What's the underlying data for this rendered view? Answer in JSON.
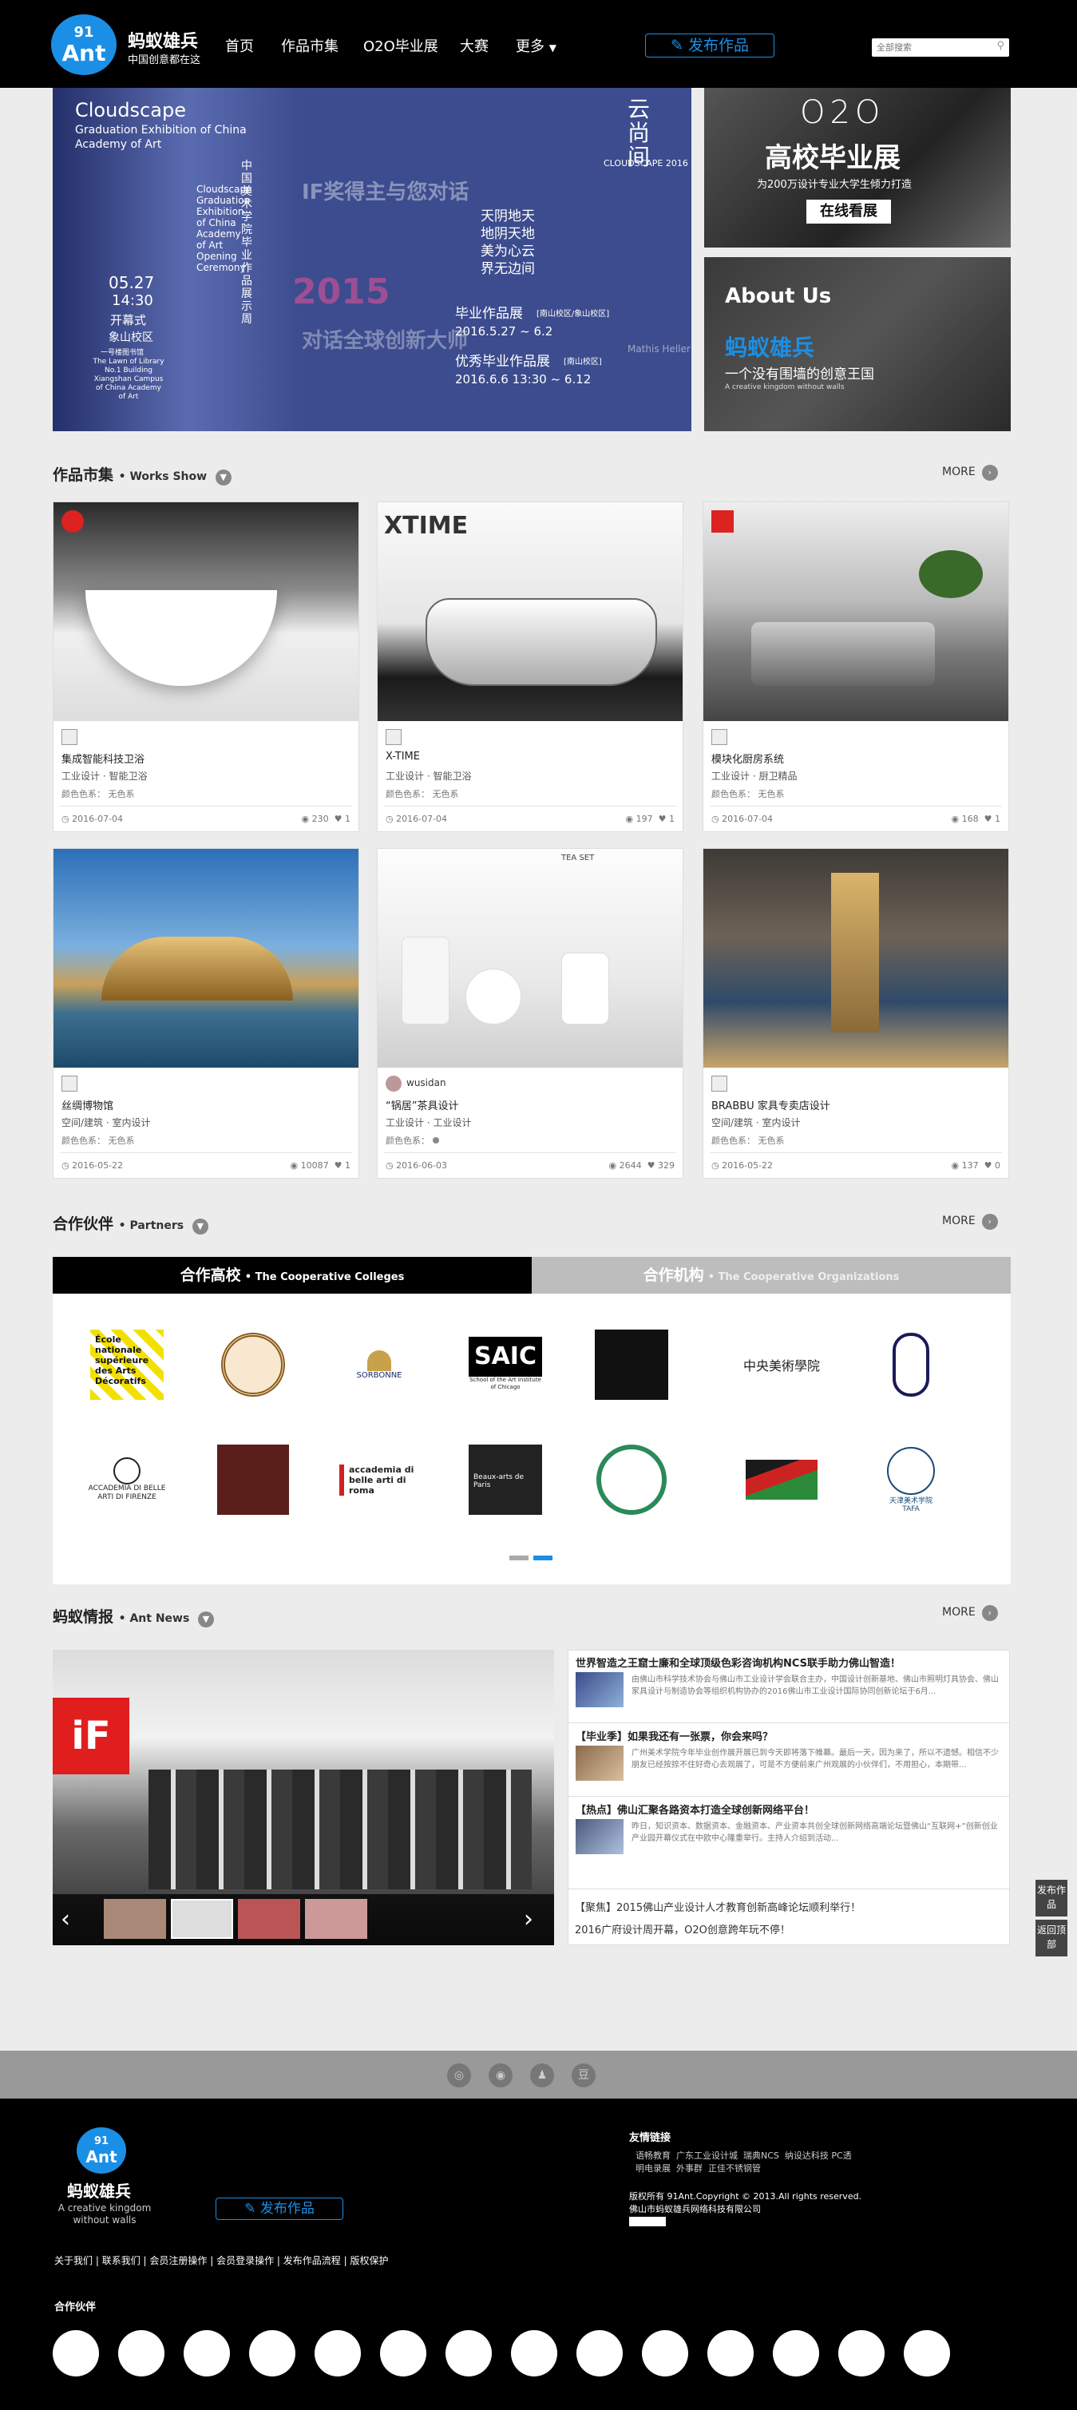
{
  "header": {
    "logo_top": "91",
    "logo_bottom": "Ant",
    "brand_name": "蚂蚁雄兵",
    "brand_slogan": "中国创意都在这",
    "nav": [
      "首页",
      "作品市集",
      "O2O毕业展",
      "大赛",
      "更多"
    ],
    "publish_label": "发布作品",
    "search_placeholder": "全部搜索"
  },
  "hero": {
    "left_title": "Cloudscape",
    "left_subtitle": "Graduation Exhibition of China Academy of Art",
    "vertical_cn": "中国美术学院毕业作品展示周",
    "vertical_en": "Cloudscape Graduation Exhibition of China Academy of Art Opening Ceremony",
    "date1": "05.27",
    "time1": "14:30",
    "open": "开幕式",
    "campus": "象山校区",
    "building": "一号楼图书馆",
    "building_en": "The Lawn of Library No.1 Building Xiangshan Campus of China Academy of Art",
    "overlay1": "IF奖得主与您对话",
    "overlay2": "对话全球创新大师",
    "year": "2015",
    "cloudscape_small": "CLOUDSCAPE 2016",
    "yunshang": "云尚间",
    "poem1": "天阴地天",
    "poem2": "地阴天地",
    "poem3": "美为心云",
    "poem4": "界无边间",
    "show1": "毕业作品展",
    "show1_place": "[南山校区/象山校区]",
    "show1_date": "2016.5.27 ~ 6.2",
    "show2": "优秀毕业作品展",
    "show2_place": "[南山校区]",
    "show2_date": "2016.6.6 13:30 ~ 6.12",
    "name": "Mathis Heller",
    "o2o_title": "O2O",
    "o2o_sub": "高校毕业展",
    "o2o_desc": "为200万设计专业大学生倾力打造",
    "o2o_button": "在线看展",
    "about_title": "About Us",
    "about_cn": "蚂蚁雄兵",
    "about_line": "一个没有围墙的创意王国",
    "about_en": "A creative kingdom without walls"
  },
  "works": {
    "title": "作品市集",
    "title_en": "Works Show",
    "more": "MORE",
    "color_label": "颜色色系：",
    "items": [
      {
        "title": "集成智能科技卫浴",
        "cat": "工业设计 · 智能卫浴",
        "color": "无色系",
        "date": "2016-07-04",
        "views": "230",
        "likes": "1",
        "author": ""
      },
      {
        "title": "X-TIME",
        "cat": "工业设计 · 智能卫浴",
        "color": "无色系",
        "date": "2016-07-04",
        "views": "197",
        "likes": "1",
        "author": ""
      },
      {
        "title": "模块化厨房系统",
        "cat": "工业设计 · 厨卫精品",
        "color": "无色系",
        "date": "2016-07-04",
        "views": "168",
        "likes": "1",
        "author": ""
      },
      {
        "title": "丝绸博物馆",
        "cat": "空间/建筑 · 室内设计",
        "color": "无色系",
        "date": "2016-05-22",
        "views": "10087",
        "likes": "1",
        "author": ""
      },
      {
        "title": "“锅居”茶具设计",
        "cat": "工业设计 · 工业设计",
        "color": "",
        "date": "2016-06-03",
        "views": "2644",
        "likes": "329",
        "author": "wusidan"
      },
      {
        "title": "BRABBU 家具专卖店设计",
        "cat": "空间/建筑 · 室内设计",
        "color": "无色系",
        "date": "2016-05-22",
        "views": "137",
        "likes": "0",
        "author": ""
      }
    ],
    "xtime_logo": "XTIME",
    "teaset": "TEA SET"
  },
  "partners": {
    "title": "合作伙伴",
    "title_en": "Partners",
    "more": "MORE",
    "tab1": "合作高校",
    "tab1_en": "The Cooperative Colleges",
    "tab2": "合作机构",
    "tab2_en": "The Cooperative Organizations",
    "ecole": "École nationale supérieure des Arts Décoratifs",
    "saic": "SAIC",
    "saic_sub": "School of the Art Institute of Chicago",
    "sorbonne": "SORBONNE",
    "cafa": "中央美術學院",
    "firenze": "ACCADEMIA DI BELLE ARTI DI FIRENZE",
    "roma": "accademia di belle arti di roma",
    "beaux": "Beaux-arts de Paris",
    "tafa": "天津美术学院",
    "tafa_en": "TAFA"
  },
  "news": {
    "title": "蚂蚁情报",
    "title_en": "Ant News",
    "more": "MORE",
    "items": [
      {
        "title": "世界智造之王窟士廉和全球顶级色彩咨询机构NCS联手助力佛山智造！",
        "desc": "由佛山市科学技术协会与佛山市工业设计学会联合主办，中国设计创新基地、佛山市照明灯具协会、佛山家具设计与制造协会等组织机构协办的2016佛山市工业设计国际协同创新论坛于6月..."
      },
      {
        "title": "【毕业季】如果我还有一张票，你会来吗？",
        "desc": "广州美术学院今年毕业创作展开展已到今天即将落下帷幕。最后一天，因为来了，所以不遗憾。相信不少朋友已经按捺不住好奇心去观展了，可是不方便前来广州观展的小伙伴们，不用担心，本期带..."
      },
      {
        "title": "【热点】佛山汇聚各路资本打造全球创新网络平台！",
        "desc": "昨日，知识资本、数据资本、金融资本、产业资本共创全球创新网络高端论坛暨佛山“互联网+”创新创业产业园开幕仪式在中欧中心隆重举行。主持人介绍到活动..."
      }
    ],
    "line1": "【聚焦】2015佛山产业设计人才教育创新高峰论坛顺利举行！",
    "line2": "2016广府设计周开幕，O2O创意跨年玩不停！"
  },
  "side": {
    "publish": "发布作品",
    "top": "返回顶部"
  },
  "footer": {
    "icons": [
      "wechat-icon",
      "weibo-icon",
      "qq-icon",
      "douban-icon"
    ],
    "brand": "蚂蚁雄兵",
    "slogan": "A creative kingdom without walls",
    "publish": "发布作品",
    "links_title": "友情链接",
    "links": [
      "语畅教育",
      "广东工业设计城",
      "瑞典NCS",
      "纳设达科技",
      "PC透明电录展",
      "外事群",
      "正佳不锈钢管"
    ],
    "copyright": "版权所有 91Ant.Copyright © 2013.All rights reserved.",
    "company": "佛山市蚂蚁雄兵网络科技有限公司",
    "bottom_links": [
      "关于我们",
      "联系我们",
      "会员注册操作",
      "会员登录操作",
      "发布作品流程",
      "版权保护"
    ],
    "partners_title": "合作伙伴"
  }
}
